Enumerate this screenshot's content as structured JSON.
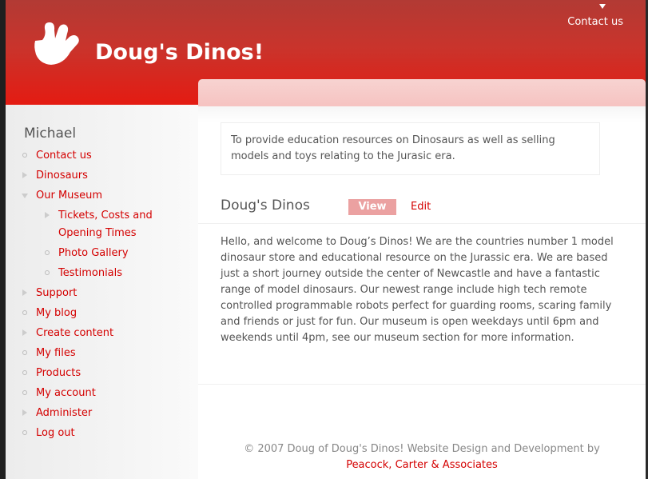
{
  "site": {
    "name": "Doug's Dinos!"
  },
  "top_nav": {
    "contact": "Contact us"
  },
  "sidebar": {
    "user": "Michael",
    "menu": [
      {
        "label": "Contact us",
        "marker": "circle"
      },
      {
        "label": "Dinosaurs",
        "marker": "triangle-right"
      },
      {
        "label": "Our Museum",
        "marker": "triangle-down",
        "children": [
          {
            "label": "Tickets, Costs and Opening Times",
            "marker": "triangle-right"
          },
          {
            "label": "Photo Gallery",
            "marker": "circle"
          },
          {
            "label": "Testimonials",
            "marker": "circle"
          }
        ]
      },
      {
        "label": "Support",
        "marker": "triangle-right"
      },
      {
        "label": "My blog",
        "marker": "circle"
      },
      {
        "label": "Create content",
        "marker": "triangle-right"
      },
      {
        "label": "My files",
        "marker": "circle"
      },
      {
        "label": "Products",
        "marker": "circle"
      },
      {
        "label": "My account",
        "marker": "circle"
      },
      {
        "label": "Administer",
        "marker": "triangle-right"
      },
      {
        "label": "Log out",
        "marker": "circle"
      }
    ]
  },
  "main": {
    "mission": "To provide education resources on Dinosaurs as well as selling models and toys relating to the Jurasic era.",
    "node_title": "Doug's Dinos",
    "tabs": {
      "view": "View",
      "edit": "Edit"
    },
    "body": "Hello, and welcome to Doug’s Dinos! We are the countries number 1 model dinosaur store and educational resource on the Jurassic era. We are based just a short journey outside the center of Newcastle and have a fantastic range of model dinosaurs. Our newest range include high tech remote controlled programmable robots perfect for guarding rooms, scaring family and friends or just for fun. Our museum is open weekdays until 6pm and weekends until 4pm, see our museum section for more information."
  },
  "footer": {
    "text": "© 2007 Doug of Doug's Dinos! Website Design and Development by",
    "link": "Peacock, Carter & Associates"
  },
  "colors": {
    "header_top": "#b23a34",
    "header_bottom": "#e41b12",
    "link": "#d40000",
    "active_tab": "#eba1a1",
    "content_band": "#f7d3d1"
  }
}
